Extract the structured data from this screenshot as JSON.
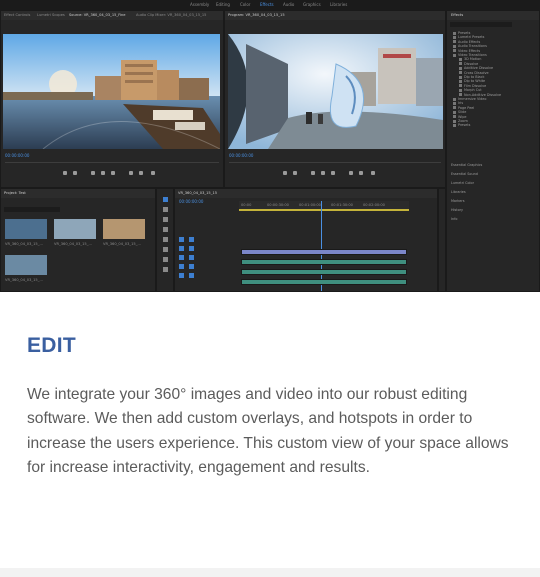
{
  "section": {
    "heading": "EDIT",
    "description": "We integrate your 360° images and video into our robust editing software. We then add custom overlays, and hotspots in order to increase the users experience. This custom view of your space allows for increase interactivity, engagement and results."
  },
  "editor": {
    "workspace_tabs": [
      "Assembly",
      "Editing",
      "Color",
      "Effects",
      "Audio",
      "Graphics",
      "Libraries"
    ],
    "source_tabs": [
      "Effect Controls",
      "Lumetri Scopes",
      "Source: VR_360_04_03_15_Fine",
      "Audio Clip Mixer: VR_360_04_03_15_15"
    ],
    "program_tab": "Program: VR_360_04_03_15_15",
    "effects_tab": "Effects",
    "effects_items": [
      "Presets",
      "Lumetri Presets",
      "Audio Effects",
      "Audio Transitions",
      "Video Effects",
      "Video Transitions",
      "3D Motion",
      "Dissolve",
      "Additive Dissolve",
      "Cross Dissolve",
      "Dip to Black",
      "Dip to White",
      "Film Dissolve",
      "Morph Cut",
      "Non-Additive Dissolve",
      "Immersive Video",
      "Iris",
      "Page Peel",
      "Slide",
      "Wipe",
      "Zoom",
      "Presets"
    ],
    "effects_sections": [
      "Essential Graphics",
      "Essential Sound",
      "Lumetri Color",
      "Libraries",
      "Markers",
      "History",
      "Info"
    ],
    "project_tab": "Project: Test",
    "timeline_tab": "VR_360_04_03_15_15",
    "timecode_source": "00:00:00:00",
    "timecode_program": "00:00:00:00",
    "timecode_timeline": "00:00:00:00",
    "clips": [
      "VR_360_04_03_15_...",
      "VR_360_04_03_15_...",
      "VR_360_04_03_15_...",
      "VR_360_04_03_15_..."
    ],
    "ruler_marks": [
      "00:00",
      "00:00:30:00",
      "00:01:00:00",
      "00:01:30:00",
      "00:02:00:00",
      "00:02:30:00"
    ]
  }
}
